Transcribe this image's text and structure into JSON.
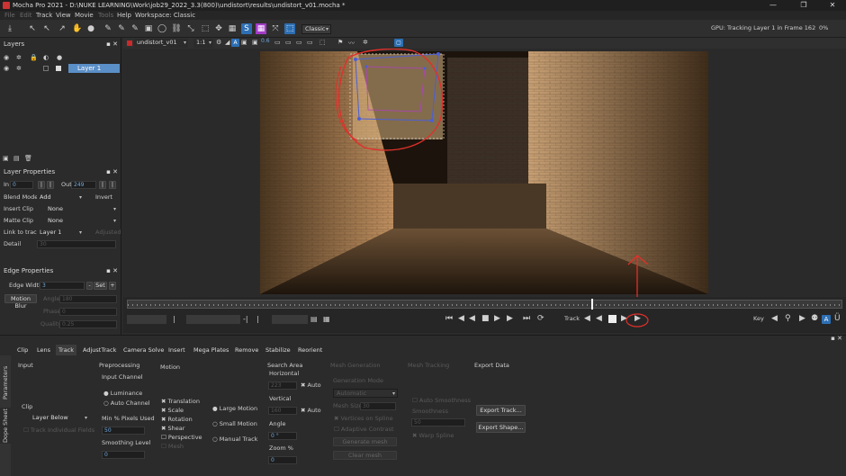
{
  "window": {
    "title": "Mocha Pro 2021 - D:\\NUKE LEARNING\\Work\\job29_2022_3.3(800)\\undistort\\results\\undistort_v01.mocha *",
    "min": "—",
    "max": "❐",
    "close": "✕"
  },
  "menu": [
    {
      "label": "File",
      "enabled": false
    },
    {
      "label": "Edit",
      "enabled": false
    },
    {
      "label": "Track",
      "enabled": true
    },
    {
      "label": "View",
      "enabled": true
    },
    {
      "label": "Movie",
      "enabled": true
    },
    {
      "label": "Tools",
      "enabled": false
    },
    {
      "label": "Help",
      "enabled": true
    },
    {
      "label": "Workspace: Classic",
      "enabled": true
    }
  ],
  "toolbar": {
    "workspace_select": "Classic",
    "status": "GPU: Tracking Layer 1 in Frame 162",
    "percent": "0%"
  },
  "viewer_toolbar": {
    "clip_select": "undistort_v01",
    "zoom_select": "1:1",
    "value": "0.6"
  },
  "layers_panel": {
    "title": "Layers",
    "layer_name": "Layer 1"
  },
  "layer_properties": {
    "title": "Layer Properties",
    "in_label": "In",
    "in_value": "0",
    "out_label": "Out",
    "out_value": "249",
    "blend_mode_label": "Blend Mode",
    "blend_mode_value": "Add",
    "invert_label": "Invert",
    "insert_clip_label": "Insert Clip",
    "insert_clip_value": "None",
    "matte_clip_label": "Matte Clip",
    "matte_clip_value": "None",
    "link_to_track_label": "Link to track",
    "link_to_track_value": "Layer 1",
    "adjusted_label": "Adjusted",
    "detail_label": "Detail",
    "detail_value": "30"
  },
  "edge_properties": {
    "title": "Edge Properties",
    "edge_width_label": "Edge Width",
    "edge_width_value": "3",
    "set_label": "Set",
    "motion_blur_label": "Motion Blur",
    "angle_label": "Angle",
    "angle_value": "180",
    "phase_label": "Phase",
    "phase_value": "0",
    "quality_label": "Quality",
    "quality_value": "0.25"
  },
  "timeline": {
    "current_frame": "162",
    "track_label": "Track",
    "key_label": "Key"
  },
  "params_tabs": [
    "Clip",
    "Lens",
    "Track",
    "AdjustTrack",
    "Camera Solve",
    "Insert",
    "Mega Plates",
    "Remove",
    "Stabilize",
    "Reorient"
  ],
  "active_tab": "Track",
  "side_tabs": [
    "Parameters",
    "Dope Sheet"
  ],
  "params": {
    "input": {
      "title": "Input",
      "clip_label": "Clip",
      "clip_value": "Layer Below",
      "track_individual_fields": "Track Individual Fields"
    },
    "preprocessing": {
      "title": "Preprocessing",
      "input_channel": "Input Channel",
      "luminance": "Luminance",
      "auto_channel": "Auto Channel",
      "min_pixels_label": "Min % Pixels Used",
      "min_pixels_value": "50",
      "smoothing_label": "Smoothing Level",
      "smoothing_value": "0"
    },
    "motion": {
      "title": "Motion",
      "translation": "Translation",
      "scale": "Scale",
      "rotation": "Rotation",
      "shear": "Shear",
      "perspective": "Perspective",
      "mesh": "Mesh",
      "large_motion": "Large Motion",
      "small_motion": "Small Motion",
      "manual_track": "Manual Track"
    },
    "search_area": {
      "title": "Search Area",
      "horizontal_label": "Horizontal",
      "horizontal_value": "223",
      "vertical_label": "Vertical",
      "vertical_value": "160",
      "auto_label": "Auto",
      "angle_label": "Angle",
      "angle_value": "0 °",
      "zoom_label": "Zoom %",
      "zoom_value": "0"
    },
    "mesh_generation": {
      "title": "Mesh Generation",
      "mode_label": "Generation Mode",
      "mode_value": "Automatic",
      "mesh_size_label": "Mesh Size",
      "mesh_size_value": "30",
      "vertices_on_spline": "Vertices on Spline",
      "adaptive_contrast": "Adaptive Contrast",
      "generate_mesh": "Generate mesh",
      "clear_mesh": "Clear mesh"
    },
    "mesh_tracking": {
      "title": "Mesh Tracking",
      "auto_smoothness": "Auto Smoothness",
      "smoothness_label": "Smoothness",
      "smoothness_value": "50",
      "warp_spline": "Warp Spline"
    },
    "export_data": {
      "title": "Export Data",
      "export_track": "Export Track...",
      "export_shape": "Export Shape..."
    }
  },
  "colors": {
    "accent": "#2d6fb3",
    "annotation": "#e0302b",
    "selection": "#4a5fd6"
  }
}
